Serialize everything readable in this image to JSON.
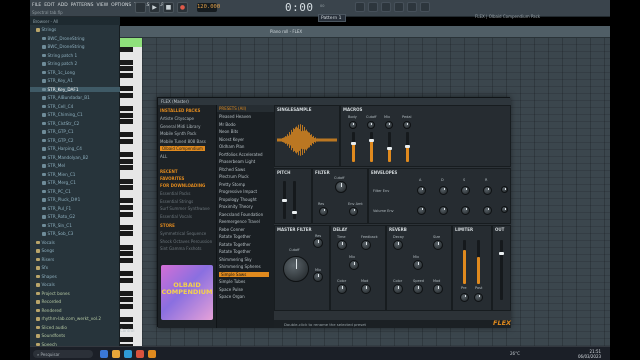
{
  "menubar": [
    "FILE",
    "EDIT",
    "ADD",
    "PATTERNS",
    "VIEW",
    "OPTIONS",
    "TOOLS",
    "HELP"
  ],
  "window_title": "Spectral tab.flp",
  "transport": {
    "bpm": "120.000",
    "time": "0:00",
    "time_sub": "00",
    "pattern": "Pattern 1"
  },
  "hint": "FLEX | Olbaid Compendium Pack",
  "piano_roll_title": "Piano roll - FLEX",
  "browser": {
    "header": "Browser - All",
    "items": [
      {
        "label": "Strings",
        "color": "#8fb1c0"
      },
      {
        "label": "BWC_DroneString",
        "color": "#8fb1c0"
      },
      {
        "label": "BWC_DroneString",
        "color": "#8fb1c0"
      },
      {
        "label": "String patch 1",
        "color": "#8fb1c0"
      },
      {
        "label": "String patch 2",
        "color": "#8fb1c0"
      },
      {
        "label": "STR_1c_Long",
        "color": "#8fb1c0"
      },
      {
        "label": "STR_Key_A1",
        "color": "#8fb1c0"
      },
      {
        "label": "STR_Key_DAF1",
        "color": "#ffffff",
        "selected": true
      },
      {
        "label": "STR_AlBundadar_B1",
        "color": "#8fb1c0"
      },
      {
        "label": "STR_Cell_C4",
        "color": "#8fb1c0"
      },
      {
        "label": "STR_Chiming_C1",
        "color": "#8fb1c0"
      },
      {
        "label": "STR_ClstStr_C2",
        "color": "#8fb1c0"
      },
      {
        "label": "STR_GTP_C1",
        "color": "#8fb1c0"
      },
      {
        "label": "STR_GTP_C2",
        "color": "#8fb1c0"
      },
      {
        "label": "STR_Harping_C4",
        "color": "#8fb1c0"
      },
      {
        "label": "STR_Mandolyan_B2",
        "color": "#8fb1c0"
      },
      {
        "label": "STR_Mel",
        "color": "#8fb1c0"
      },
      {
        "label": "STR_Mien_C1",
        "color": "#8fb1c0"
      },
      {
        "label": "STR_Merg_C1",
        "color": "#8fb1c0"
      },
      {
        "label": "STR_PC_C1",
        "color": "#8fb1c0"
      },
      {
        "label": "STR_Pluck_D#1",
        "color": "#8fb1c0"
      },
      {
        "label": "STR_Pul_F1",
        "color": "#8fb1c0"
      },
      {
        "label": "STR_Roto_G2",
        "color": "#8fb1c0"
      },
      {
        "label": "STR_Sln_C1",
        "color": "#8fb1c0"
      },
      {
        "label": "STR_Sob_C3",
        "color": "#8fb1c0"
      },
      {
        "label": "Vocals",
        "color": "#8fb1c0"
      },
      {
        "label": "Songs",
        "color": "#8fb1c0"
      },
      {
        "label": "Risers",
        "color": "#8fb1c0"
      },
      {
        "label": "Sfx",
        "color": "#8fb1c0"
      },
      {
        "label": "Shapes",
        "color": "#8fb1c0"
      },
      {
        "label": "Vocals",
        "color": "#8fb1c0"
      },
      {
        "label": "Project bones",
        "color": "#b5c9a3"
      },
      {
        "label": "Recorded",
        "color": "#b5c9a3"
      },
      {
        "label": "Rendered",
        "color": "#b5c9a3"
      },
      {
        "label": "rhythm-lab.com_werkt_vol.2",
        "color": "#b5c9a3"
      },
      {
        "label": "Sliced audio",
        "color": "#b5c9a3"
      },
      {
        "label": "Soundfonts",
        "color": "#b5c9a3"
      },
      {
        "label": "Speech",
        "color": "#b5c9a3"
      },
      {
        "label": "Templates",
        "color": "#b5c9a3"
      }
    ]
  },
  "flex": {
    "title": "FLEX (Master)",
    "installed_head": "INSTALLED PACKS",
    "packs": [
      "Artiste Cityscape",
      "General Midi Library",
      "Mobile Synth Pack",
      "Mobile Tuned 808 Bass",
      "Olbaid Compendium",
      "ALL"
    ],
    "selected_pack": "Olbaid Compendium",
    "recent_head": "RECENT",
    "favorites_head": "FAVORITES",
    "download_head": "FOR DOWNLOADING",
    "download_items": [
      "Essential Packs",
      "Essential Strings",
      "Surf Summer Synthwave",
      "Essential Vocals"
    ],
    "store_head": "STORE",
    "store_items": [
      "Symmetrical Sequence",
      "Shock Octaves Percussion",
      "Sint Gamma Fxshots"
    ],
    "cover_text": "OLBAID COMPENDIUM",
    "presets_head": "PRESETS (All)",
    "presets": [
      "Pleased Heaven",
      "Mr Bodo",
      "Neon Bits",
      "Nicest Keyer",
      "Oldham Plan",
      "Portfolios Accelerated",
      "Phaserbeam Light",
      "Pitched Saws",
      "Plectrum Pluck",
      "Pretty Stomp",
      "Progressive Impact",
      "Propology Thought",
      "Proximity Theory",
      "Raecsland Foundation",
      "Reemergence Travel",
      "Rebe Conner",
      "Rotate Together",
      "Rotate Together",
      "Rotate Together",
      "Shimmering Sky",
      "Shimmering Spheres",
      "Simple Saws",
      "Simple Tubes",
      "Space Pulse",
      "Space Organ"
    ],
    "selected_preset": "Simple Saws",
    "sample_label": "SINGLESAMPLE",
    "macros": {
      "label": "MACROS",
      "items": [
        "Body",
        "Cutoff",
        "Mix",
        "Pedal"
      ],
      "levels": [
        0.62,
        0.74,
        0.48,
        0.55
      ]
    },
    "pitch_label": "PITCH",
    "filter": {
      "label": "FILTER",
      "knobs": [
        "Cutoff",
        "Res",
        "Env Amt"
      ]
    },
    "envelopes": {
      "label": "ENVELOPES",
      "filter": "Filter Env",
      "volume": "Volume Env",
      "adsr": [
        "A",
        "D",
        "S",
        "R"
      ]
    },
    "master_filter": {
      "label": "MASTER FILTER",
      "knobs": [
        "Cutoff",
        "Res",
        "Mix"
      ]
    },
    "delay": {
      "label": "DELAY",
      "knobs": [
        "Time",
        "Feedback",
        "Mix",
        "Color",
        "Mod"
      ]
    },
    "reverb": {
      "label": "REVERB",
      "knobs": [
        "Decay",
        "Size",
        "Mix",
        "Color",
        "Speed",
        "Mod"
      ]
    },
    "limiter": {
      "label": "LIMITER",
      "knobs": [
        "Pre",
        "Post"
      ],
      "levels": [
        0.78,
        0.62
      ]
    },
    "out_label": "OUT",
    "status": "Double-click to rename the selected preset",
    "logo": "FLEX"
  },
  "tool_label": "Control",
  "taskbar": {
    "search_placeholder": "Pesquisar",
    "tray": "26°C",
    "time": "21:51",
    "date": "06/03/2023"
  }
}
